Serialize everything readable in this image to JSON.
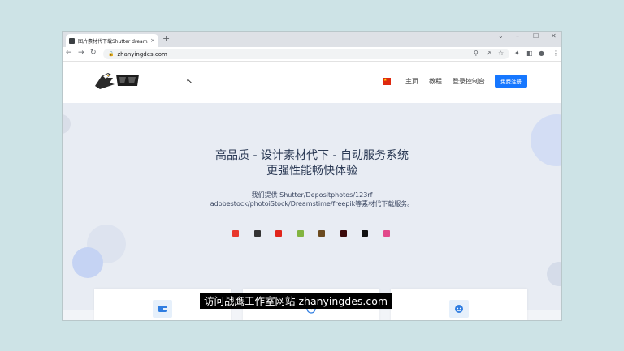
{
  "browser": {
    "tab_title": "图片素材代下载Shutter dreams",
    "tab_close": "×",
    "new_tab": "+",
    "window_controls": {
      "chevron": "⌄",
      "minimize": "–",
      "maximize": "☐",
      "close": "✕"
    },
    "nav": {
      "back": "←",
      "forward": "→",
      "reload": "↻"
    },
    "url": "zhanyingdes.com"
  },
  "site": {
    "nav_links": [
      "主页",
      "教程",
      "登录控制台"
    ],
    "signup_label": "免费注册",
    "hero": {
      "headline_line1": "高品质 - 设计素材代下 - 自动服务系统",
      "headline_line2": "更强性能畅快体验",
      "subline_line1": "我们提供 Shutter/Depositphotos/123rf",
      "subline_line2": "adobestock/photoiStock/Dreamstime/freepik等素材代下载服务。"
    },
    "brand_icons": [
      {
        "name": "shutterstock-icon",
        "color": "#e8372c"
      },
      {
        "name": "depositphotos-icon",
        "color": "#333333"
      },
      {
        "name": "123rf-icon",
        "color": "#e1251b"
      },
      {
        "name": "envato-icon",
        "color": "#82b440"
      },
      {
        "name": "dreamstime-icon",
        "color": "#6b4a1f"
      },
      {
        "name": "adobe-stock-icon",
        "color": "#3b0a0a"
      },
      {
        "name": "istock-icon",
        "color": "#111111"
      },
      {
        "name": "freepik-icon",
        "color": "#e2498a"
      }
    ]
  },
  "caption": "访问战鹰工作室网站 zhanyingdes.com",
  "colors": {
    "accent": "#1677ff",
    "hero_bg": "#e8ecf3"
  }
}
